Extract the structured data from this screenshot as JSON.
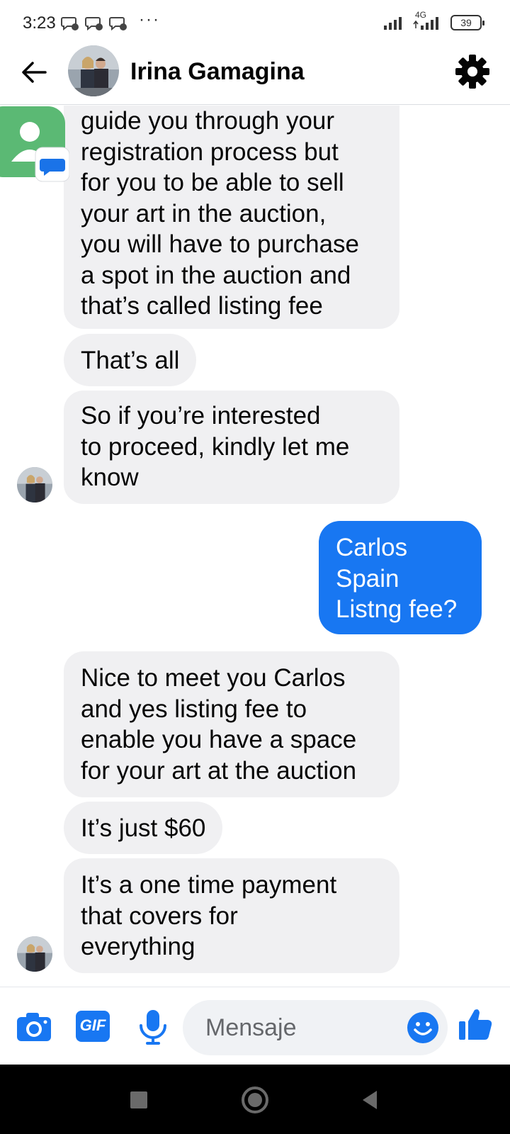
{
  "status_bar": {
    "time": "3:23",
    "overflow_dots": "···",
    "network": "4G",
    "battery": "39"
  },
  "header": {
    "contact_name": "Irina Gamagina"
  },
  "messages": [
    {
      "from": "contact",
      "text": "guide you through your\nregistration process but\nfor you to be able to sell\nyour art in the auction,\nyou will have to purchase\na spot in the auction and\nthat’s called listing fee"
    },
    {
      "from": "contact",
      "text": "That’s all"
    },
    {
      "from": "contact",
      "text": "So if you’re interested\nto proceed, kindly let me\nknow"
    },
    {
      "from": "me",
      "text": "Carlos\nSpain\nListng fee?"
    },
    {
      "from": "contact",
      "text": "Nice to meet you Carlos\nand yes listing fee to\nenable you have a space\nfor your art at the auction"
    },
    {
      "from": "contact",
      "text": "It’s just $60"
    },
    {
      "from": "contact",
      "text": "It’s a one time payment\nthat covers for\neverything"
    }
  ],
  "composer": {
    "placeholder": "Mensaje",
    "gif_label": "GIF"
  },
  "colors": {
    "brand_blue": "#1877f2",
    "incoming_bubble": "#f0f0f2",
    "contacts_green": "#5bb974"
  },
  "icons": [
    "back-arrow-icon",
    "gear-icon",
    "camera-icon",
    "gif-icon",
    "microphone-icon",
    "emoji-icon",
    "thumbs-up-icon",
    "square-nav-icon",
    "circle-nav-icon",
    "triangle-nav-icon"
  ]
}
